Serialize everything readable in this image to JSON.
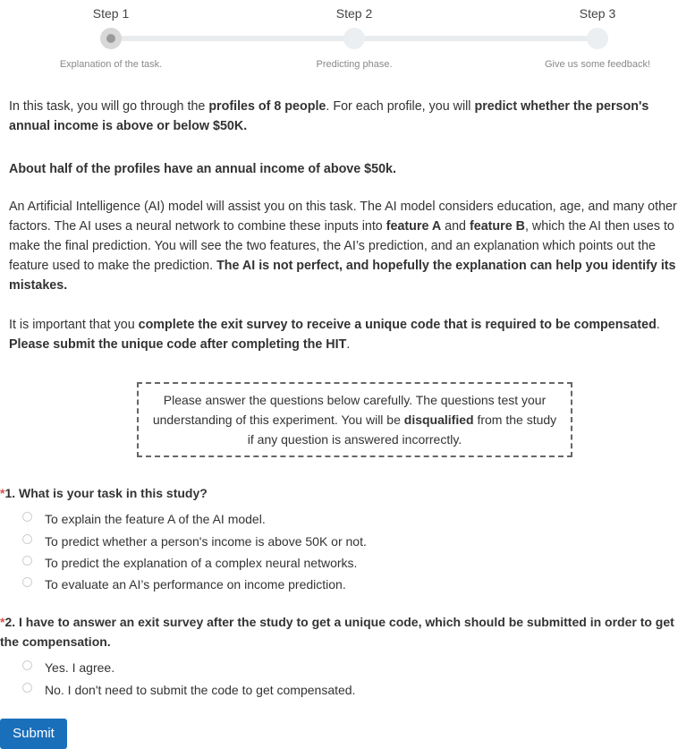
{
  "stepper": {
    "steps": [
      {
        "title": "Step 1",
        "desc": "Explanation of the task."
      },
      {
        "title": "Step 2",
        "desc": "Predicting phase."
      },
      {
        "title": "Step 3",
        "desc": "Give us some feedback!"
      }
    ],
    "active_index": 0
  },
  "intro": {
    "p1": [
      "In this task, you will go through the ",
      "profiles of 8 people",
      ". For each profile, you will ",
      "predict whether the person's annual income is above or below $50K."
    ],
    "p2": "About half of the profiles have an annual income of above $50k.",
    "p3": [
      "An Artificial Intelligence (AI) model will assist you on this task. The AI model considers education, age, and many other factors. The AI uses a neural network to combine these inputs into ",
      "feature A",
      " and ",
      "feature B",
      ", which the AI then uses to make the final prediction. You will see the two features, the AI’s prediction, and an explanation which points out the feature used to make the prediction. ",
      "The AI is not perfect, and hopefully the explanation can help you identify its mistakes."
    ],
    "p4": [
      "It is important that you ",
      "complete the exit survey to receive a unique code that is required to be compensated",
      ". ",
      "Please submit the unique code after completing the HIT",
      "."
    ]
  },
  "notice": [
    "Please answer the questions below carefully. The questions test your understanding of this experiment. You will be ",
    "disqualified",
    " from the study if any question is answered incorrectly."
  ],
  "questions": [
    {
      "star": "*",
      "text": "1. What is your task in this study?",
      "options": [
        "To explain the feature A of the AI model.",
        "To predict whether a person's income is above 50K or not.",
        "To predict the explanation of a complex neural networks.",
        "To evaluate an AI’s performance on income prediction."
      ]
    },
    {
      "star": "*",
      "text": "2. I have to answer an exit survey after the study to get a unique code, which should be submitted in order to get the compensation.",
      "options": [
        "Yes. I agree.",
        "No. I don't need to submit the code to get compensated."
      ]
    }
  ],
  "submit_label": "Submit",
  "colors": {
    "required_star": "#d9534f",
    "submit_bg": "#1a6fba",
    "active_step_dot": "#9a9a9a"
  }
}
